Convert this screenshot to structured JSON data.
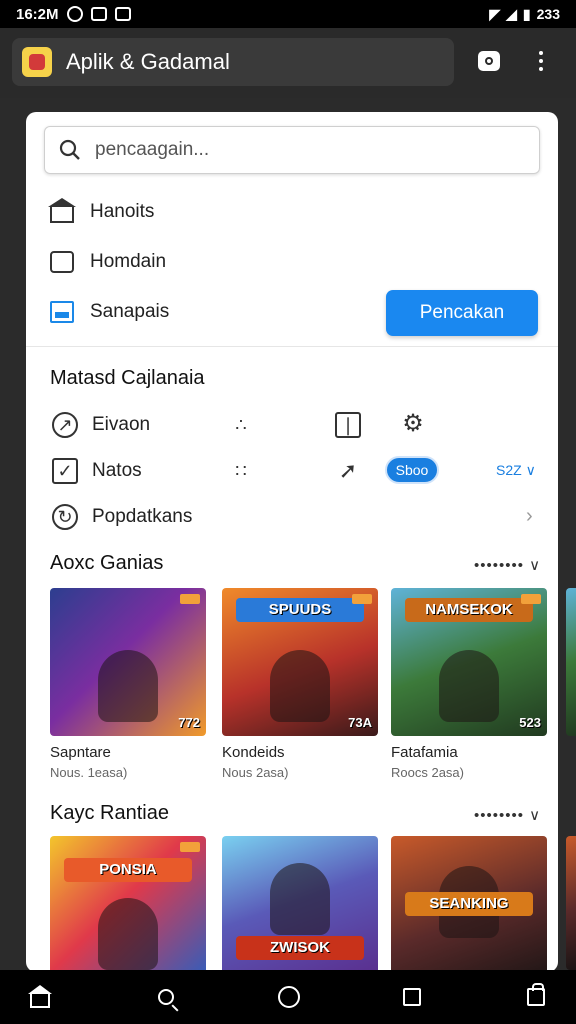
{
  "status_bar": {
    "time": "16:2M",
    "battery": "233"
  },
  "app_header": {
    "title": "Aplik & Gadamal"
  },
  "search": {
    "placeholder": "pencaagain..."
  },
  "menu": {
    "items": [
      {
        "label": "Hanoits",
        "icon": "home-icon"
      },
      {
        "label": "Homdain",
        "icon": "square-icon"
      },
      {
        "label": "Sanapais",
        "icon": "window-icon"
      }
    ],
    "primary_button": "Pencakan"
  },
  "categories": {
    "title": "Matasd Cajlanaia",
    "items": [
      {
        "label": "Eivaon",
        "icon": "compass-icon"
      },
      {
        "label": "Natos",
        "icon": "checkbox-icon"
      },
      {
        "label": "Popdatkans",
        "icon": "refresh-icon"
      }
    ],
    "pill": "Sboo",
    "link": "S2Z ∨"
  },
  "section1": {
    "title": "Aoxc Ganias",
    "more": "•••••••• ∨",
    "cards": [
      {
        "name": "Sapntare",
        "sub": "Nous. 1easa)",
        "rating": "772",
        "badge": ""
      },
      {
        "name": "Kondeids",
        "sub": "Nous 2asa)",
        "rating": "73A",
        "badge": "SPUUDS"
      },
      {
        "name": "Fatafamia",
        "sub": "Roocs 2asa)",
        "rating": "523",
        "badge": "NAMSEKOK"
      }
    ]
  },
  "section2": {
    "title": "Kayc Rantiae",
    "more": "•••••••• ∨",
    "cards": [
      {
        "badge": "PONSIA"
      },
      {
        "badge": "ZWISOK"
      },
      {
        "badge": "SEANKING"
      }
    ]
  },
  "colors": {
    "accent": "#1a88f0",
    "header_bg": "#2a2a2a",
    "panel_bg": "#ffffff"
  }
}
